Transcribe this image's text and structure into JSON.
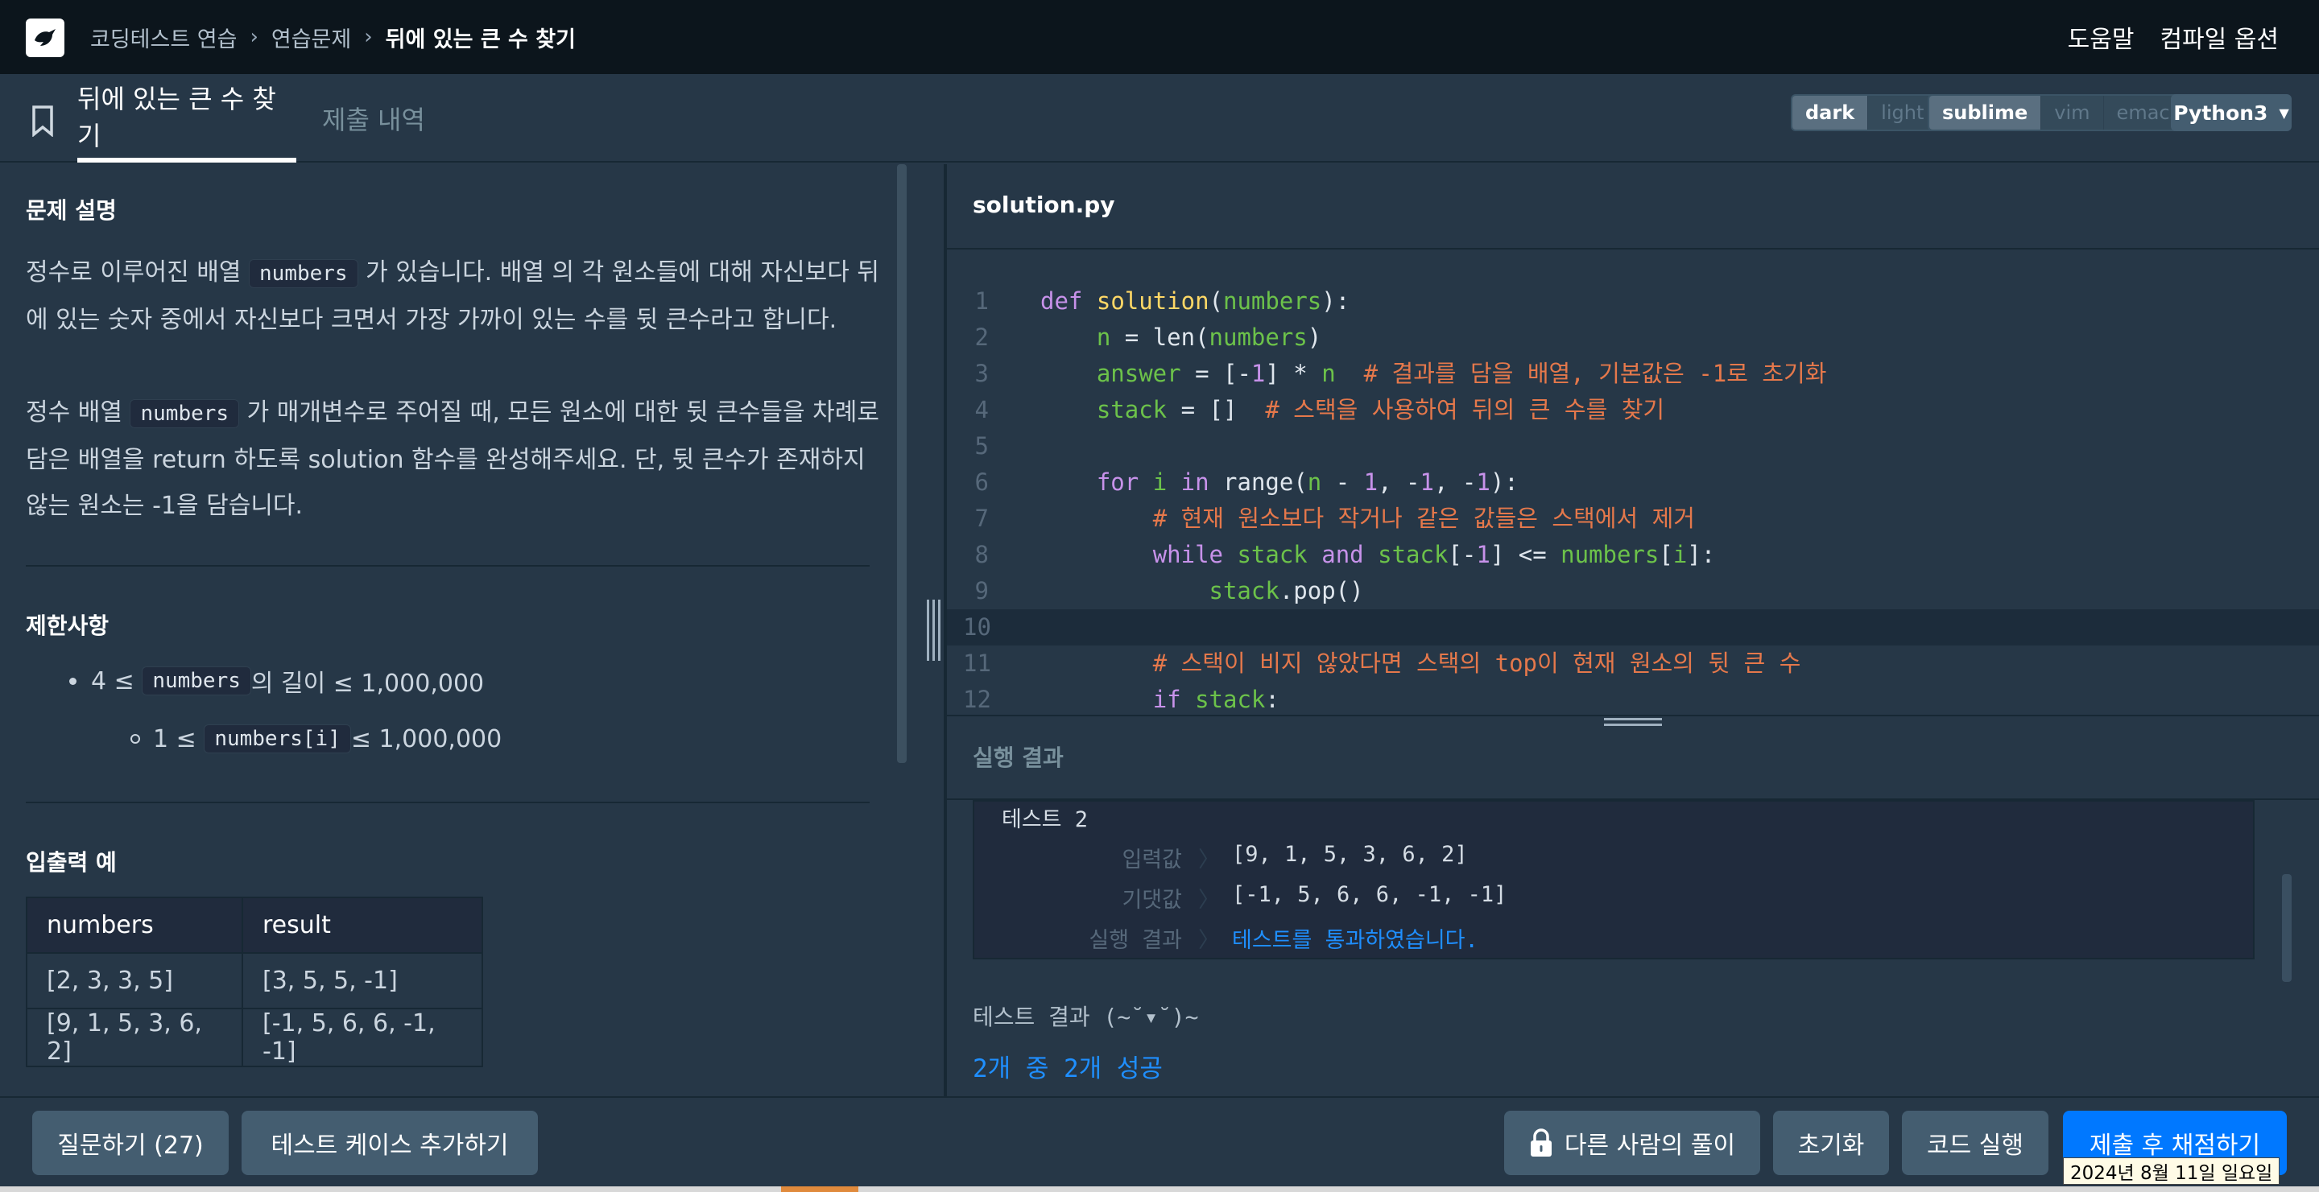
{
  "breadcrumb": {
    "items": [
      "코딩테스트 연습",
      "연습문제",
      "뒤에 있는 큰 수 찾기"
    ]
  },
  "header_links": {
    "help": "도움말",
    "compile_options": "컴파일 옵션"
  },
  "tabs": {
    "problem": "뒤에 있는 큰 수 찾기",
    "submissions": "제출 내역"
  },
  "theme": {
    "options": [
      "dark",
      "light"
    ],
    "selected": "dark"
  },
  "keymap": {
    "options": [
      "sublime",
      "vim",
      "emacs"
    ],
    "selected": "sublime"
  },
  "language": {
    "selected": "Python3"
  },
  "problem": {
    "description_title": "문제 설명",
    "p1_a": "정수로 이루어진 배열 ",
    "p1_code": "numbers",
    "p1_b": " 가 있습니다. 배열 의 각 원소들에 대해 자신보다 뒤에 있는 숫자 중에서 자신보다 크면서 가장 가까이 있는 수를 뒷 큰수라고 합니다.",
    "p2_a": "정수 배열 ",
    "p2_code": "numbers",
    "p2_b": " 가 매개변수로 주어질 때, 모든 원소에 대한 뒷 큰수들을 차례로 담은 배열을 return 하도록 solution 함수를 완성해주세요. 단, 뒷 큰수가 존재하지 않는 원소는 -1을 담습니다.",
    "constraints_title": "제한사항",
    "c1_a": "4 ≤ ",
    "c1_code": "numbers",
    "c1_b": " 의 길이 ≤ 1,000,000",
    "c2_a": "1 ≤ ",
    "c2_code": "numbers[i]",
    "c2_b": " ≤ 1,000,000",
    "io_title": "입출력 예",
    "io_headers": [
      "numbers",
      "result"
    ],
    "io_rows": [
      [
        "[2, 3, 3, 5]",
        "[3, 5, 5, -1]"
      ],
      [
        "[9, 1, 5, 3, 6, 2]",
        "[-1, 5, 6, 6, -1, -1]"
      ]
    ]
  },
  "editor": {
    "filename": "solution.py",
    "line_numbers": [
      "1",
      "2",
      "3",
      "4",
      "5",
      "6",
      "7",
      "8",
      "9",
      "10",
      "11",
      "12"
    ]
  },
  "result": {
    "title": "실행 결과",
    "test_name": "테스트 2",
    "input_label": "입력값",
    "input_value": "[9, 1, 5, 3, 6, 2]",
    "expected_label": "기댓값",
    "expected_value": "[-1, 5, 6, 6, -1, -1]",
    "result_label": "실행 결과",
    "result_value": "테스트를 통과하였습니다.",
    "arrow": "〉",
    "summary_head": "테스트 결과 (~˘▾˘)~",
    "summary": "2개 중 2개 성공"
  },
  "buttons": {
    "ask": "질문하기 (27)",
    "add_case": "테스트 케이스 추가하기",
    "others_solutions": "다른 사람의 풀이",
    "reset": "초기화",
    "run": "코드 실행",
    "submit": "제출 후 채점하기"
  },
  "tooltip": {
    "date": "2024년 8월 11일 일요일"
  }
}
